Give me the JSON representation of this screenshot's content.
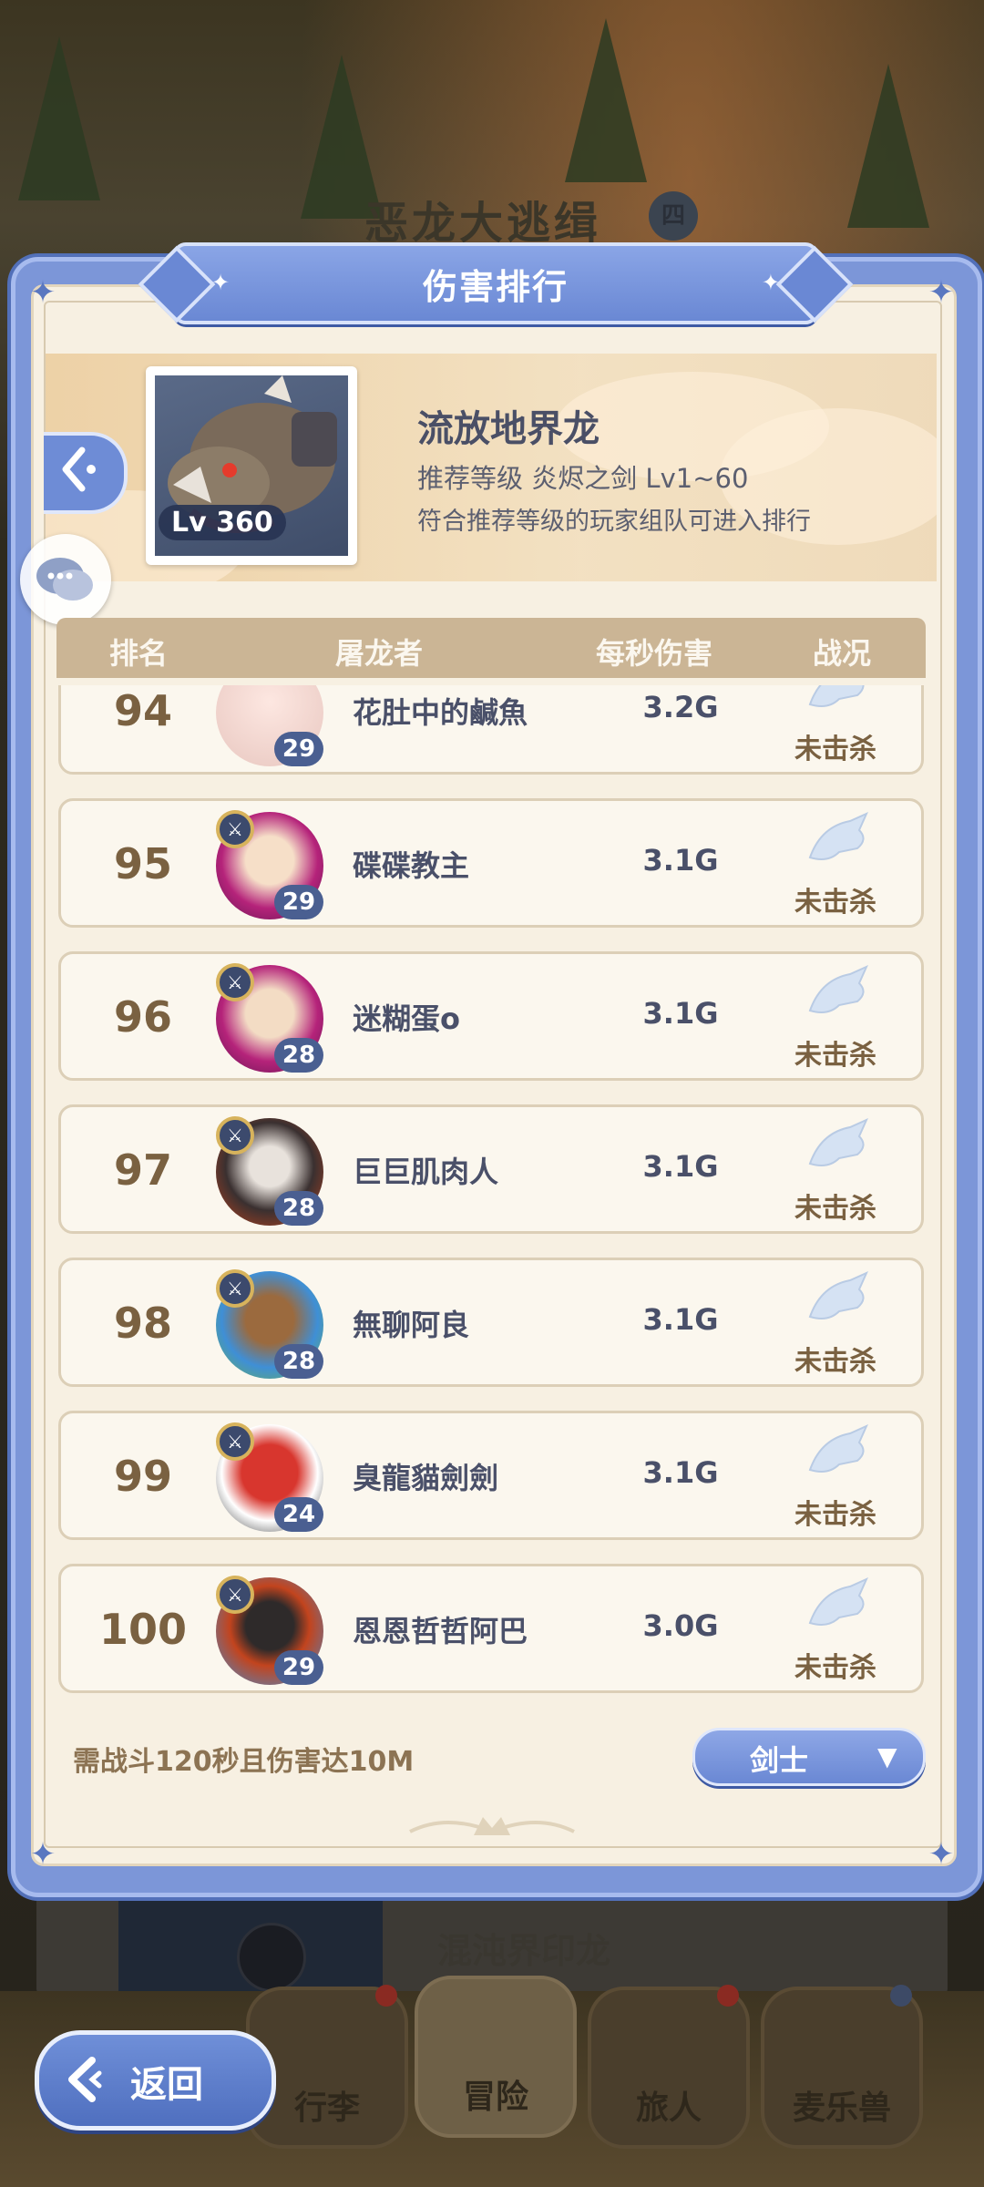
{
  "background": {
    "event_title": "恶龙大逃缉",
    "event_badge": "四",
    "card_title": "混沌界印龙",
    "nav": [
      {
        "label": "行李"
      },
      {
        "label": "冒险"
      },
      {
        "label": "旅人"
      },
      {
        "label": "麦乐兽"
      }
    ],
    "back_label": "返回"
  },
  "dialog": {
    "title": "伤害排行",
    "boss": {
      "name": "流放地界龙",
      "level": "Lv 360",
      "recommend": "推荐等级  炎烬之剑  Lv1~60",
      "note": "符合推荐等级的玩家组队可进入排行"
    },
    "columns": {
      "rank": "排名",
      "player": "屠龙者",
      "dps": "每秒伤害",
      "status": "战况"
    },
    "rows": [
      {
        "rank": "94",
        "name": "花肚中的鹹魚",
        "level": "29",
        "dps": "3.2G",
        "status": "未击杀"
      },
      {
        "rank": "95",
        "name": "碟碟教主",
        "level": "29",
        "dps": "3.1G",
        "status": "未击杀"
      },
      {
        "rank": "96",
        "name": "迷糊蛋o",
        "level": "28",
        "dps": "3.1G",
        "status": "未击杀"
      },
      {
        "rank": "97",
        "name": "巨巨肌肉人",
        "level": "28",
        "dps": "3.1G",
        "status": "未击杀"
      },
      {
        "rank": "98",
        "name": "無聊阿良",
        "level": "28",
        "dps": "3.1G",
        "status": "未击杀"
      },
      {
        "rank": "99",
        "name": "臭龍貓劍劍",
        "level": "24",
        "dps": "3.1G",
        "status": "未击杀"
      },
      {
        "rank": "100",
        "name": "恩恩哲哲阿巴",
        "level": "29",
        "dps": "3.0G",
        "status": "未击杀"
      }
    ],
    "requirement": "需战斗120秒且伤害达10M",
    "class_filter": {
      "label": "剑士",
      "caret": "▼"
    }
  },
  "colors": {
    "frame_blue": "#7c96d8",
    "panel_cream": "#f7f0e2",
    "rank_brown": "#7a6141",
    "text_navy": "#4a5069"
  }
}
